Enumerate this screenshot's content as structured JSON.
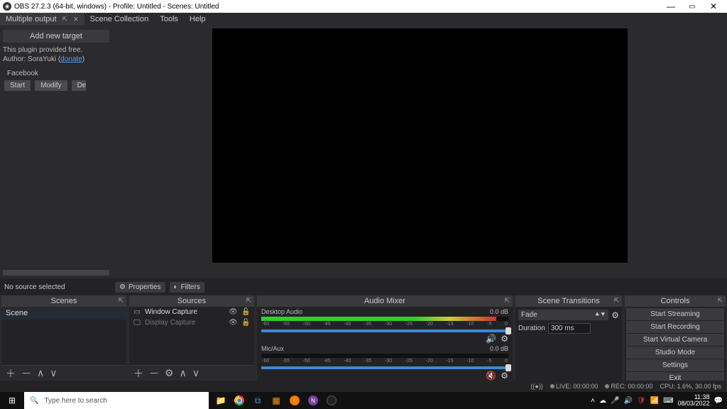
{
  "titlebar": {
    "title": "OBS 27.2.3 (64-bit, windows) - Profile: Untitled - Scenes: Untitled"
  },
  "dockTab": {
    "label": "Multiple output"
  },
  "menu": {
    "sceneCollection": "Scene Collection",
    "tools": "Tools",
    "help": "Help"
  },
  "leftPanel": {
    "addTarget": "Add new target",
    "pluginLine1": "This plugin provided free.",
    "pluginLine2a": "Author: SoraYuki (",
    "donate": "donate",
    "pluginLine2b": ")",
    "facebook": "Facebook",
    "start": "Start",
    "modify": "Modify",
    "delete": "De"
  },
  "midbar": {
    "noSource": "No source selected",
    "properties": "Properties",
    "filters": "Filters"
  },
  "scenes": {
    "title": "Scenes",
    "item": "Scene"
  },
  "sources": {
    "title": "Sources",
    "items": [
      {
        "name": "Window Capture",
        "visible": true
      },
      {
        "name": "Display Capture",
        "visible": false
      }
    ]
  },
  "mixer": {
    "title": "Audio Mixer",
    "ch": [
      {
        "name": "Desktop Audio",
        "db": "0.0 dB",
        "level": 95,
        "slider": 100,
        "muted": false
      },
      {
        "name": "Mic/Aux",
        "db": "0.0 dB",
        "level": 0,
        "slider": 100,
        "muted": true
      }
    ],
    "ticks": [
      "-60",
      "-55",
      "-50",
      "-45",
      "-40",
      "-35",
      "-30",
      "-25",
      "-20",
      "-15",
      "-10",
      "-5",
      "0"
    ]
  },
  "transitions": {
    "title": "Scene Transitions",
    "selected": "Fade",
    "durationLabel": "Duration",
    "durationValue": "300 ms"
  },
  "controls": {
    "title": "Controls",
    "buttons": [
      "Start Streaming",
      "Start Recording",
      "Start Virtual Camera",
      "Studio Mode",
      "Settings",
      "Exit"
    ]
  },
  "statusbar": {
    "live": "LIVE: 00:00:00",
    "rec": "REC: 00:00:00",
    "cpu": "CPU: 1.6%, 30.00 fps"
  },
  "taskbar": {
    "searchPlaceholder": "Type here to search",
    "time": "11:38",
    "date": "08/03/2022"
  }
}
